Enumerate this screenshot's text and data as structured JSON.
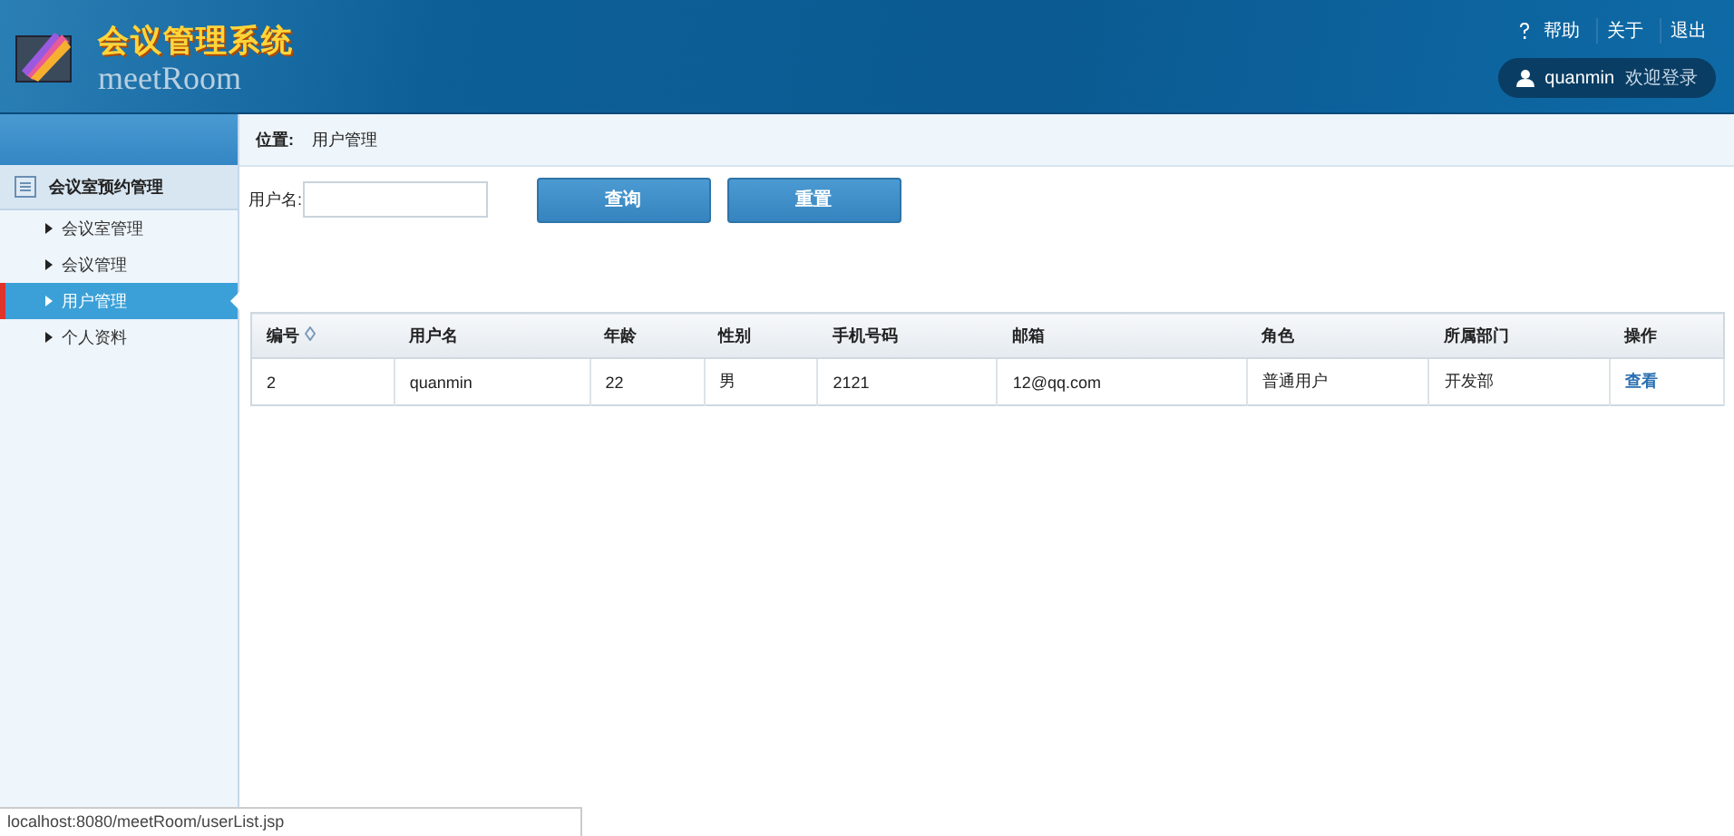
{
  "header": {
    "title": "会议管理系统",
    "subtitle": "meetRoom",
    "links": [
      "帮助",
      "关于",
      "退出"
    ],
    "user": "quanmin",
    "greeting": "欢迎登录"
  },
  "breadcrumb": {
    "label": "位置:",
    "current": "用户管理"
  },
  "sidebar": {
    "group": "会议室预约管理",
    "items": [
      {
        "label": "会议室管理",
        "selected": false
      },
      {
        "label": "会议管理",
        "selected": false
      },
      {
        "label": "用户管理",
        "selected": true
      },
      {
        "label": "个人资料",
        "selected": false
      }
    ]
  },
  "search": {
    "label": "用户名:",
    "buttons": [
      "查询",
      "重置"
    ]
  },
  "table": {
    "columns": [
      {
        "label": "编号",
        "sortable": true
      },
      {
        "label": "用户名",
        "sortable": false
      },
      {
        "label": "年龄",
        "sortable": false
      },
      {
        "label": "性别",
        "sortable": false
      },
      {
        "label": "手机号码",
        "sortable": false
      },
      {
        "label": "邮箱",
        "sortable": false
      },
      {
        "label": "角色",
        "sortable": false
      },
      {
        "label": "所属部门",
        "sortable": false
      },
      {
        "label": "操作",
        "sortable": false
      }
    ],
    "rows": [
      {
        "cells": [
          "2",
          "quanmin",
          "22",
          "男",
          "2121",
          "12@qq.com",
          "普通用户",
          "开发部"
        ],
        "action": "查看"
      }
    ]
  },
  "status_bar": "localhost:8080/meetRoom/userList.jsp"
}
